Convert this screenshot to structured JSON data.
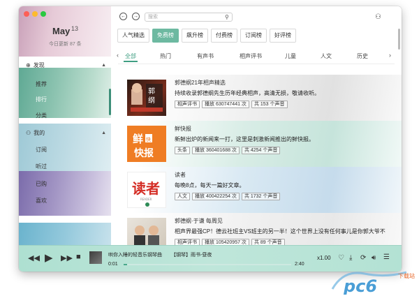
{
  "sidebar": {
    "date_month": "May",
    "date_day": "13",
    "update_text": "今日更新 87 条",
    "discover_label": "发现",
    "discover_items": [
      {
        "label": "推荐"
      },
      {
        "label": "排行"
      },
      {
        "label": "分类"
      }
    ],
    "mine_label": "我的",
    "mine_items": [
      {
        "label": "订阅"
      },
      {
        "label": "听过"
      },
      {
        "label": "已购"
      },
      {
        "label": "喜欢"
      }
    ]
  },
  "topbar": {
    "search_placeholder": "搜索"
  },
  "tabs": [
    {
      "label": "人气精选"
    },
    {
      "label": "免费榜"
    },
    {
      "label": "飙升榜"
    },
    {
      "label": "付费榜"
    },
    {
      "label": "订阅榜"
    },
    {
      "label": "好评榜"
    }
  ],
  "categories": [
    {
      "label": "全部"
    },
    {
      "label": "热门"
    },
    {
      "label": "有声书"
    },
    {
      "label": "相声评书"
    },
    {
      "label": "儿童"
    },
    {
      "label": "人文"
    },
    {
      "label": "历史"
    }
  ],
  "rows": [
    {
      "title": "郭德纲21年相声精选",
      "desc": "持续收录郭德纲先生历年经典相声，高清无损，敬请收听。",
      "tag": "相声评书",
      "plays": "播放 630747441 次",
      "count": "共 153 个声音",
      "cover_text": "郭德纲"
    },
    {
      "title": "鲜快报",
      "desc": "新鲜出炉的新闻来一打，这里是刺激新闻推出的鲜快报。",
      "tag": "头条",
      "plays": "播放 360401688 次",
      "count": "共 4254 个声音",
      "cover_text": "鲜快报"
    },
    {
      "title": "读者",
      "desc": "每晚8点，每天一篇好文章。",
      "tag": "人文",
      "plays": "播放 400422254 次",
      "count": "共 1732 个声音",
      "cover_text": "读者"
    },
    {
      "title": "郭德纲·于谦 每周见",
      "desc": "相声界最强CP！德云社班主VS班主的另一半！这个世界上没有任何事儿是你郭大爷不",
      "tag": "相声评书",
      "plays": "播放 105420957 次",
      "count": "共 89 个声音",
      "cover_text": "郭德纲于谦"
    }
  ],
  "player": {
    "title": "哄你入睡的轻音乐钢琴曲",
    "subtitle": "【钢琴】雨书-昼夜",
    "current_time": "0:01",
    "duration": "2:40",
    "speed": "x1.00",
    "progress": 0.01
  },
  "watermark": {
    "text": "pc6",
    "sub": "下载站"
  },
  "colors": {
    "accent": "#6db9a1",
    "accent_dark": "#3f9e82"
  }
}
